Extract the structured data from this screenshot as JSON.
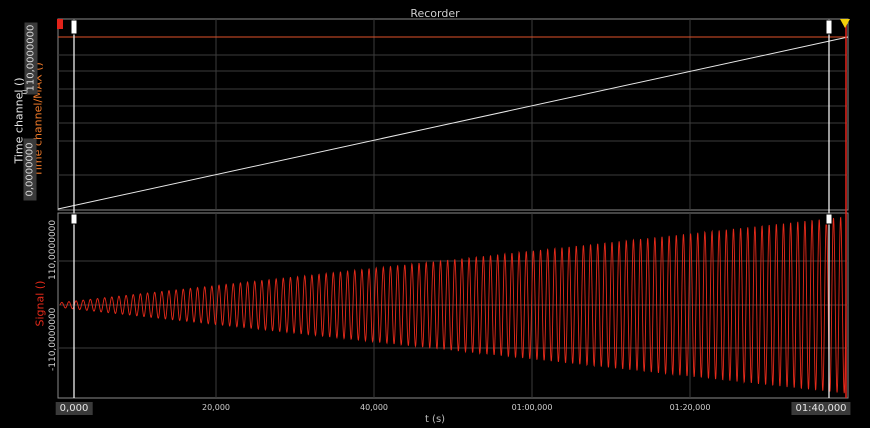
{
  "window": {
    "title": "Recorder"
  },
  "colors": {
    "background": "#000000",
    "grid": "#3c3c3c",
    "frame": "#8a8a8a",
    "time_trace": "#e8e8e8",
    "max_line": "#e0522a",
    "signal_trace": "#e62a1a",
    "cursor": "#ffffff",
    "marker_red": "#e2231a",
    "marker_yellow": "#f4d10a"
  },
  "panels": {
    "top": {
      "axis_left_label": "Time channel ()",
      "axis_right_label": "Time channel/MAX ()",
      "tick_top": "110,0000000",
      "tick_bottom": "0,0000000",
      "tick_top_small": "0,",
      "tick_bottom_small": "0000000"
    },
    "bottom": {
      "axis_label": "Signal ()",
      "tick_top": "110,0000000",
      "tick_bottom": "-110,0000000"
    }
  },
  "xaxis": {
    "title": "t (s)",
    "ticks": [
      "20,000",
      "40,000",
      "01:00,000",
      "01:20,000"
    ],
    "cursor_left": "0,000",
    "cursor_right": "01:40,000"
  },
  "chart_data": {
    "type": "line",
    "x_range_seconds": [
      0,
      101
    ],
    "series": [
      {
        "name": "Time channel ()",
        "note_x": [
          0,
          101
        ],
        "values": [
          0,
          110
        ]
      },
      {
        "name": "Signal ()",
        "amplitude_start": 3,
        "amplitude_end": 110,
        "cycles": 110
      }
    ],
    "ylim_top": [
      0,
      110
    ],
    "ylim_bottom": [
      -110,
      110
    ],
    "grid": true
  }
}
